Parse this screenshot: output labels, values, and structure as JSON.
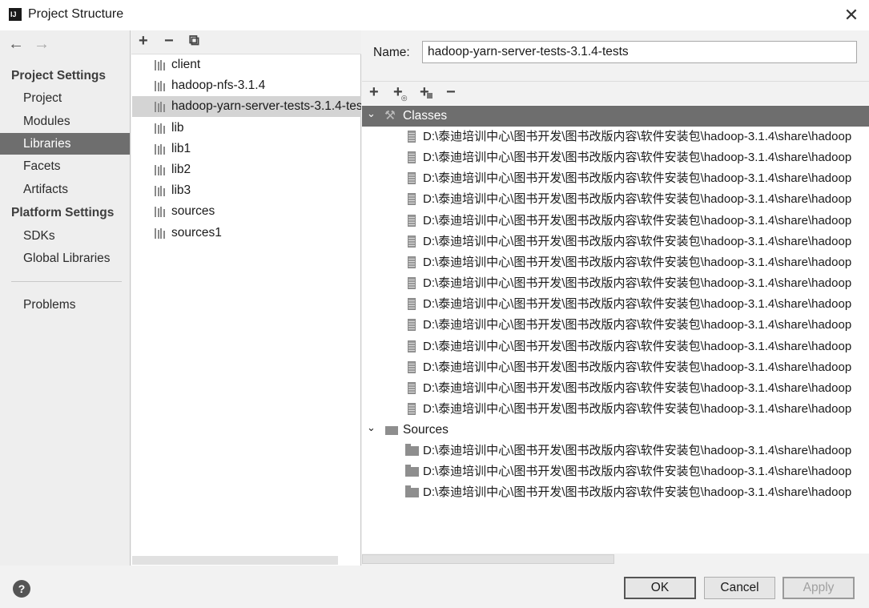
{
  "window": {
    "title": "Project Structure",
    "app_icon": "IJ",
    "close_glyph": "✕"
  },
  "nav": {
    "back_glyph": "←",
    "forward_glyph": "→",
    "sections": {
      "project_settings": "Project Settings",
      "platform_settings": "Platform Settings"
    },
    "items": {
      "project": "Project",
      "modules": "Modules",
      "libraries": "Libraries",
      "facets": "Facets",
      "artifacts": "Artifacts",
      "sdks": "SDKs",
      "global_libraries": "Global Libraries",
      "problems": "Problems"
    },
    "selected": "Libraries"
  },
  "library_toolbar": {
    "add": "+",
    "remove": "−",
    "copy": "⧉"
  },
  "libraries": [
    "client",
    "hadoop-nfs-3.1.4",
    "hadoop-yarn-server-tests-3.1.4-tests",
    "lib",
    "lib1",
    "lib2",
    "lib3",
    "sources",
    "sources1"
  ],
  "selected_library": "hadoop-yarn-server-tests-3.1.4-tests",
  "details": {
    "name_label": "Name:",
    "name_value": "hadoop-yarn-server-tests-3.1.4-tests",
    "toolbar": {
      "add": "+",
      "add_alt": "+",
      "add_alt2": "+",
      "remove": "−"
    },
    "classes_label": "Classes",
    "sources_label": "Sources",
    "classes_path": "D:\\泰迪培训中心\\图书开发\\图书改版内容\\软件安装包\\hadoop-3.1.4\\share\\hadoop",
    "sources_path": "D:\\泰迪培训中心\\图书开发\\图书改版内容\\软件安装包\\hadoop-3.1.4\\share\\hadoop",
    "classes_count": 14,
    "sources_count": 3
  },
  "buttons": {
    "ok": "OK",
    "cancel": "Cancel",
    "apply": "Apply",
    "help": "?"
  },
  "chev_down": "⌄"
}
